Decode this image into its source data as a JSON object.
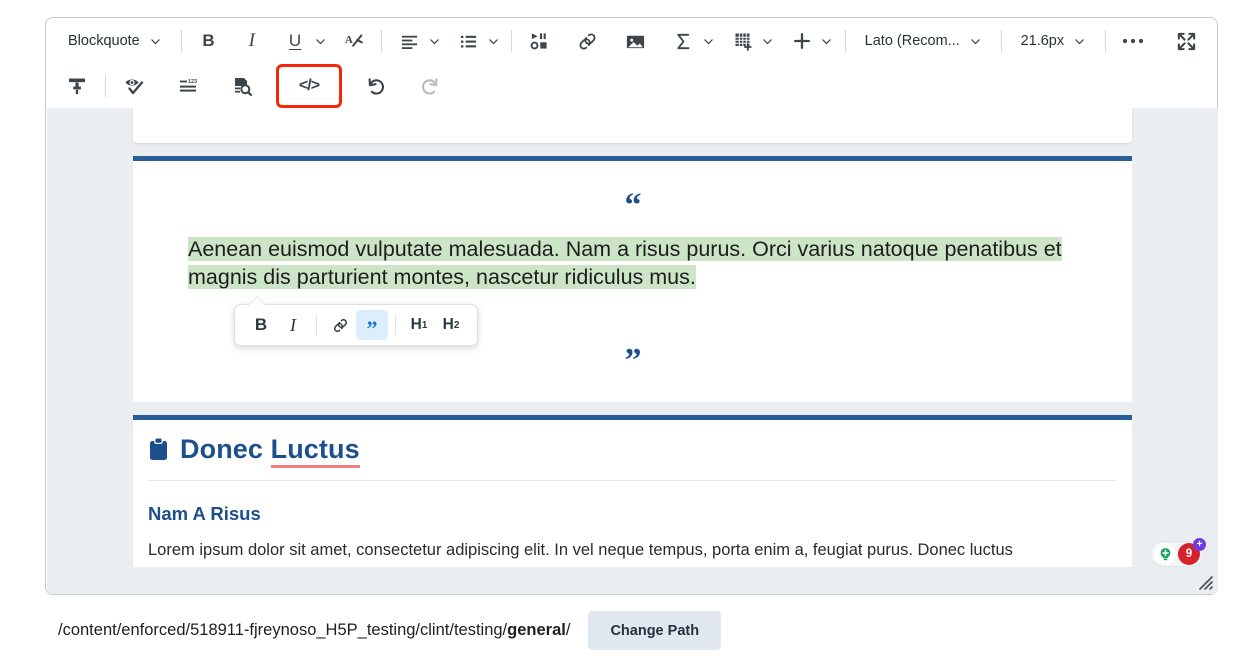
{
  "toolbar": {
    "row1": {
      "style_dropdown": {
        "label": "Blockquote",
        "icon": "chevron-down-icon"
      },
      "bold": "B",
      "italic": "I",
      "underline": "U",
      "format_clear": "Ay",
      "align": "align-left-icon",
      "list": "bullet-list-icon",
      "media": "media-icon",
      "link": "link-icon",
      "image": "image-icon",
      "equation": "sigma-icon",
      "table": "table-icon",
      "insert": "plus-icon",
      "font_family": "Lato (Recom...",
      "font_size": "21.6px",
      "more": "ellipsis-icon",
      "fullscreen": "fullscreen-icon"
    },
    "row2": {
      "format_painter": "format-painter-icon",
      "accessibility": "accessibility-check-icon",
      "word_count": "word-count-icon",
      "preview": "preview-icon",
      "source_code": "</>",
      "undo": "undo-icon",
      "redo": "redo-icon"
    }
  },
  "floating_toolbar": {
    "bold": "B",
    "italic": "I",
    "link": "link-icon",
    "quote": "quote-icon",
    "h1_label": "H",
    "h1_sub": "1",
    "h2_label": "H",
    "h2_sub": "2"
  },
  "content": {
    "quote_open_mark": "“",
    "quote_close_mark": "”",
    "quote_selected": "Aenean euismod vulputate malesuada. Nam a risus purus. Orci varius natoque penatibus et magnis dis parturient montes, nascetur ridiculus mus.",
    "section_icon": "clipboard-icon",
    "section_title_plain": "Donec ",
    "section_title_misspelled": "Luctus",
    "subsection_title": "Nam A Risus",
    "body_paragraph": "Lorem ipsum dolor sit amet, consectetur adipiscing elit. In vel neque tempus, porta enim a, feugiat purus. Donec luctus"
  },
  "grammarly": {
    "bulb": "lightbulb-icon",
    "issue_count": "9",
    "premium_plus": "+"
  },
  "pathbar": {
    "path_prefix": "/content/enforced/518911-fjreynoso_H5P_testing/clint/testing/",
    "path_bold": "general",
    "path_suffix": "/",
    "change_path_label": "Change Path"
  },
  "colors": {
    "accent_blue": "#1d4f8c",
    "rule_blue": "#2a5e96",
    "selection_green": "#cde5c7",
    "highlight_red": "#f5270b",
    "active_blue_bg": "#dbeefc",
    "misspell_underline": "#f08080",
    "editor_bg": "#eaeef1",
    "badge_red": "#d6222c",
    "badge_purple": "#6f3de0",
    "bulb_green": "#16a05a"
  }
}
